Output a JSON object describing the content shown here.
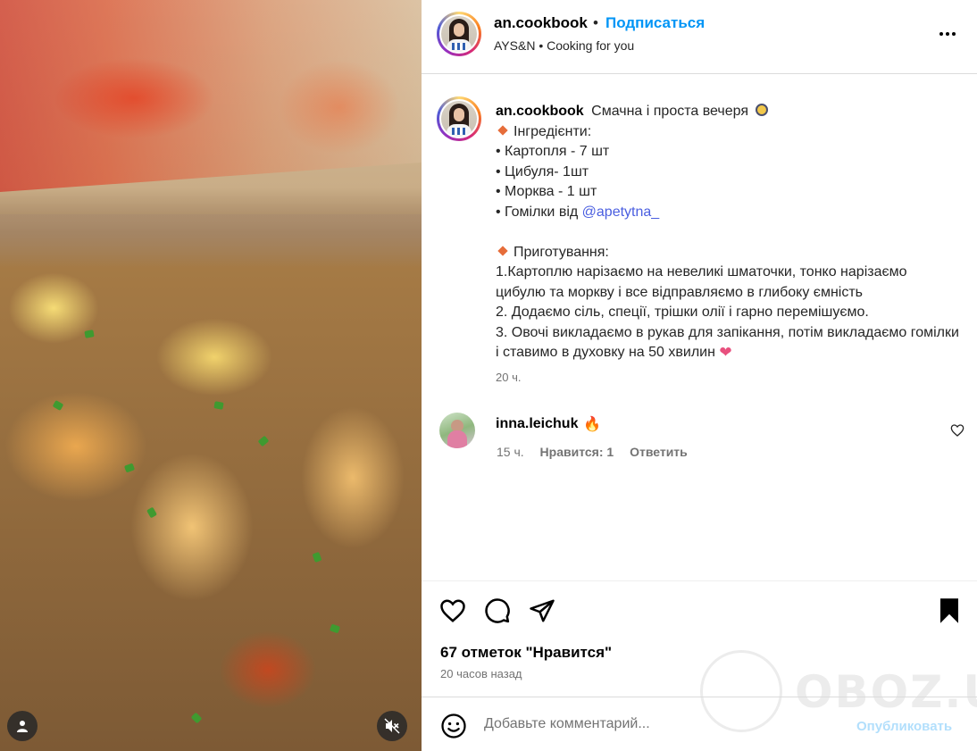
{
  "post": {
    "username": "an.cookbook",
    "follow_label": "Подписаться",
    "separator": "•",
    "subtitle": "AYS&N • Cooking for you",
    "caption": {
      "username": "an.cookbook",
      "title": "Смачна і проста вечеря",
      "ingredients_heading": "Інгредієнти:",
      "ingredients": [
        "• Картопля - 7 шт",
        "• Цибуля- 1шт",
        "• Морква - 1 шт",
        "• Гомілки від "
      ],
      "mention": "@apetytna_",
      "cooking_heading": "Приготування:",
      "steps": [
        "1.Картоплю нарізаємо на невеликі шматочки, тонко нарізаємо цибулю та моркву і все відправляємо в глибоку ємність",
        "2. Додаємо сіль, спеції, трішки олії і гарно перемішуємо.",
        "3. Овочі викладаємо в рукав для запікання, потім викладаємо гомілки і ставимо в духовку на 50 хвилин"
      ],
      "time": "20 ч."
    },
    "comment": {
      "username": "inna.leichuk",
      "time": "15 ч.",
      "likes": "Нравится: 1",
      "reply_label": "Ответить"
    },
    "likes_count": "67 отметок \"Нравится\"",
    "posted_ago": "20 часов назад",
    "comment_placeholder": "Добавьте комментарий...",
    "publish_label": "Опубликовать"
  },
  "watermark": "OBOZ.UA",
  "icons": {
    "more": "more-horizontal-icon",
    "like": "heart-icon",
    "comment": "comment-bubble-icon",
    "share": "paper-plane-icon",
    "save": "bookmark-icon",
    "emoji": "smiley-icon",
    "user": "user-icon",
    "mute": "muted-speaker-icon"
  },
  "colors": {
    "link_blue": "#0095f6",
    "mention": "#4a5ee0",
    "publish_disabled": "#b2dffc",
    "muted_text": "#737373"
  }
}
